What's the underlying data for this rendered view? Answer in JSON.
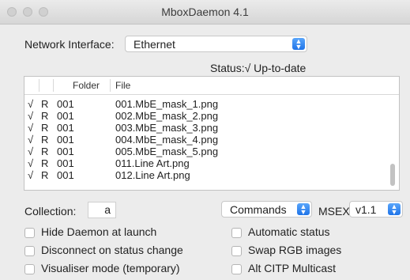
{
  "window": {
    "title": "MboxDaemon 4.1"
  },
  "network": {
    "label": "Network Interface:",
    "value": "Ethernet"
  },
  "status": {
    "text": "Status:√ Up-to-date"
  },
  "table": {
    "columns": [
      "",
      "",
      "Folder",
      "File"
    ],
    "rows": [
      {
        "check": "√",
        "flag": "R",
        "folder": "001",
        "file": "001.MbE_mask_1.png"
      },
      {
        "check": "√",
        "flag": "R",
        "folder": "001",
        "file": "002.MbE_mask_2.png"
      },
      {
        "check": "√",
        "flag": "R",
        "folder": "001",
        "file": "003.MbE_mask_3.png"
      },
      {
        "check": "√",
        "flag": "R",
        "folder": "001",
        "file": "004.MbE_mask_4.png"
      },
      {
        "check": "√",
        "flag": "R",
        "folder": "001",
        "file": "005.MbE_mask_5.png"
      },
      {
        "check": "√",
        "flag": "R",
        "folder": "001",
        "file": "011.Line Art.png"
      },
      {
        "check": "√",
        "flag": "R",
        "folder": "001",
        "file": "012.Line Art.png"
      }
    ]
  },
  "collection": {
    "label": "Collection:",
    "value": "a"
  },
  "commands": {
    "value": "Commands"
  },
  "msex": {
    "label": "MSEX",
    "value": "v1.1"
  },
  "options": {
    "left": [
      {
        "label": "Hide Daemon at launch",
        "checked": false
      },
      {
        "label": "Disconnect on status change",
        "checked": false
      },
      {
        "label": "Visualiser mode (temporary)",
        "checked": false
      }
    ],
    "right": [
      {
        "label": "Automatic status",
        "checked": false
      },
      {
        "label": "Swap RGB images",
        "checked": false
      },
      {
        "label": "Alt CITP Multicast",
        "checked": false
      }
    ]
  },
  "colors": {
    "accent": "#2b7ff0",
    "window_bg": "#ececec"
  }
}
